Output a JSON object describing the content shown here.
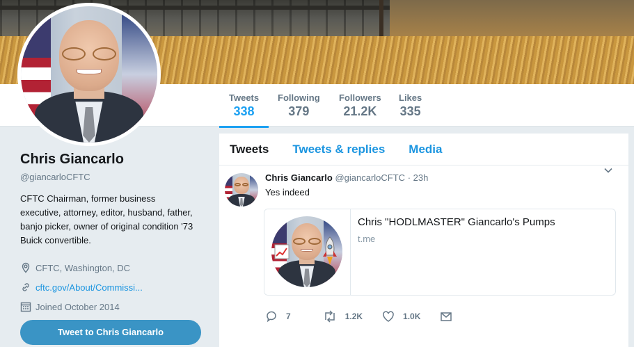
{
  "profile": {
    "name": "Chris Giancarlo",
    "handle": "@giancarloCFTC",
    "bio": "CFTC Chairman, former business executive, attorney, editor, husband, father, banjo picker, owner of original condition '73 Buick convertible.",
    "location": "CFTC, Washington, DC",
    "website": "cftc.gov/About/Commissi...",
    "joined": "Joined October 2014",
    "tweet_to_label": "Tweet to Chris Giancarlo"
  },
  "stats": [
    {
      "label": "Tweets",
      "value": "338",
      "active": true
    },
    {
      "label": "Following",
      "value": "379",
      "active": false
    },
    {
      "label": "Followers",
      "value": "21.2K",
      "active": false
    },
    {
      "label": "Likes",
      "value": "335",
      "active": false
    }
  ],
  "tabs": [
    {
      "label": "Tweets",
      "active": true
    },
    {
      "label": "Tweets & replies",
      "active": false
    },
    {
      "label": "Media",
      "active": false
    }
  ],
  "tweet": {
    "name": "Chris Giancarlo",
    "handle": "@giancarloCFTC",
    "separator": "·",
    "time": "23h",
    "text": "Yes indeed",
    "card": {
      "title": "Chris \"HODLMASTER\" Giancarlo's Pumps",
      "domain": "t.me"
    },
    "actions": {
      "replies": "7",
      "retweets": "1.2K",
      "likes": "1.0K"
    }
  },
  "colors": {
    "accent": "#1da1f2",
    "link": "#1b95e0",
    "button": "#3a94c5",
    "muted": "#657786"
  }
}
